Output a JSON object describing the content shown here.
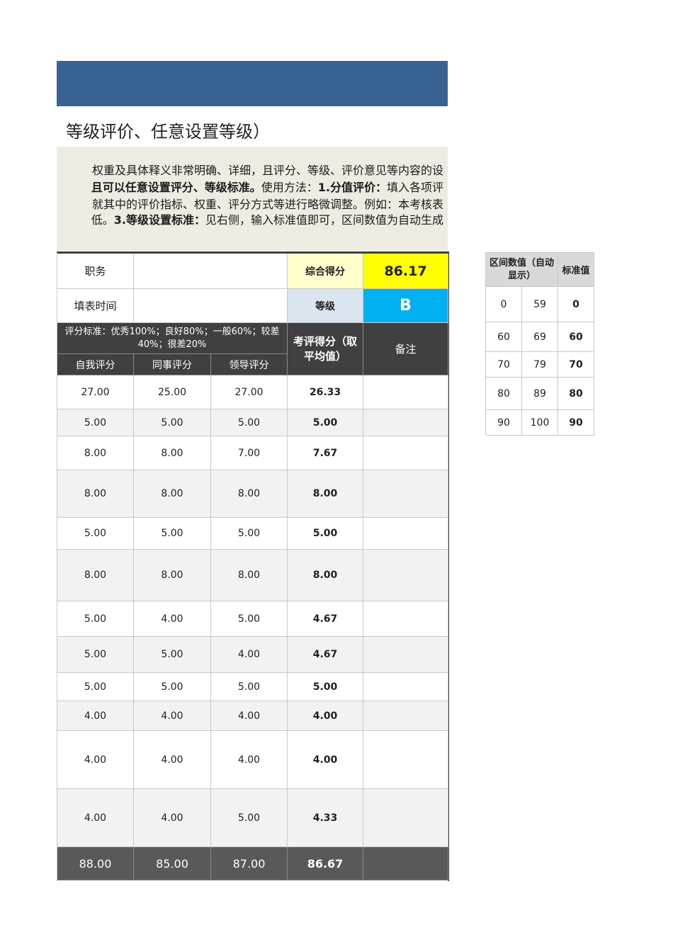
{
  "title_fragment": "等级评价、任意设置等级）",
  "description": {
    "line1": "权重及具体释义非常明确、详细，且评分、等级、评价意见等内容的设",
    "line2_bold": "且可以任意设置评分、等级标准。",
    "line2_normal": "使用方法：",
    "line2_bold2": "1.分值评价：",
    "line2_tail": "填入各项评",
    "line3": "就其中的评价指标、权重、评分方式等进行略微调整。例如：本考核表",
    "line4_start": "低。",
    "line4_bold": "3.等级设置标准：",
    "line4_tail": "见右侧，输入标准值即可，区间数值为自动生成"
  },
  "header": {
    "position_label": "职务",
    "position_value": "",
    "date_label": "填表时间",
    "date_value": "",
    "total_score_label": "综合得分",
    "total_score_value": "86.17",
    "grade_label": "等级",
    "grade_value": "B",
    "criteria_text": "评分标准：优秀100%；良好80%；一般60%；较差40%；很差20%",
    "avg_label": "考评得分（取平均值）",
    "remark_label": "备注",
    "col_self": "自我评分",
    "col_peer": "同事评分",
    "col_leader": "领导评分"
  },
  "rows": [
    {
      "self": "27.00",
      "peer": "25.00",
      "leader": "27.00",
      "avg": "26.33",
      "remark": ""
    },
    {
      "self": "5.00",
      "peer": "5.00",
      "leader": "5.00",
      "avg": "5.00",
      "remark": ""
    },
    {
      "self": "8.00",
      "peer": "8.00",
      "leader": "7.00",
      "avg": "7.67",
      "remark": ""
    },
    {
      "self": "8.00",
      "peer": "8.00",
      "leader": "8.00",
      "avg": "8.00",
      "remark": ""
    },
    {
      "self": "5.00",
      "peer": "5.00",
      "leader": "5.00",
      "avg": "5.00",
      "remark": ""
    },
    {
      "self": "8.00",
      "peer": "8.00",
      "leader": "8.00",
      "avg": "8.00",
      "remark": ""
    },
    {
      "self": "5.00",
      "peer": "4.00",
      "leader": "5.00",
      "avg": "4.67",
      "remark": ""
    },
    {
      "self": "5.00",
      "peer": "5.00",
      "leader": "4.00",
      "avg": "4.67",
      "remark": ""
    },
    {
      "self": "5.00",
      "peer": "5.00",
      "leader": "5.00",
      "avg": "5.00",
      "remark": ""
    },
    {
      "self": "4.00",
      "peer": "4.00",
      "leader": "4.00",
      "avg": "4.00",
      "remark": ""
    },
    {
      "self": "4.00",
      "peer": "4.00",
      "leader": "4.00",
      "avg": "4.00",
      "remark": ""
    },
    {
      "self": "4.00",
      "peer": "4.00",
      "leader": "5.00",
      "avg": "4.33",
      "remark": ""
    }
  ],
  "totals": {
    "self": "88.00",
    "peer": "85.00",
    "leader": "87.00",
    "avg": "86.67",
    "remark": ""
  },
  "grade_table": {
    "col_range": "区间数值（自动显示）",
    "col_standard": "标准值",
    "rows": [
      {
        "low": "0",
        "high": "59",
        "std": "0"
      },
      {
        "low": "60",
        "high": "69",
        "std": "60"
      },
      {
        "low": "70",
        "high": "79",
        "std": "70"
      },
      {
        "low": "80",
        "high": "89",
        "std": "80"
      },
      {
        "low": "90",
        "high": "100",
        "std": "90"
      }
    ]
  },
  "colors": {
    "banner": "#386291",
    "description_bg": "#eeece1",
    "total_score_bg": "#ffff00",
    "grade_bg": "#00b0f0",
    "label_bg": "#ffffcc",
    "grade_label_bg": "#dce6f1",
    "dark_header": "#404040",
    "footer": "#595959"
  }
}
